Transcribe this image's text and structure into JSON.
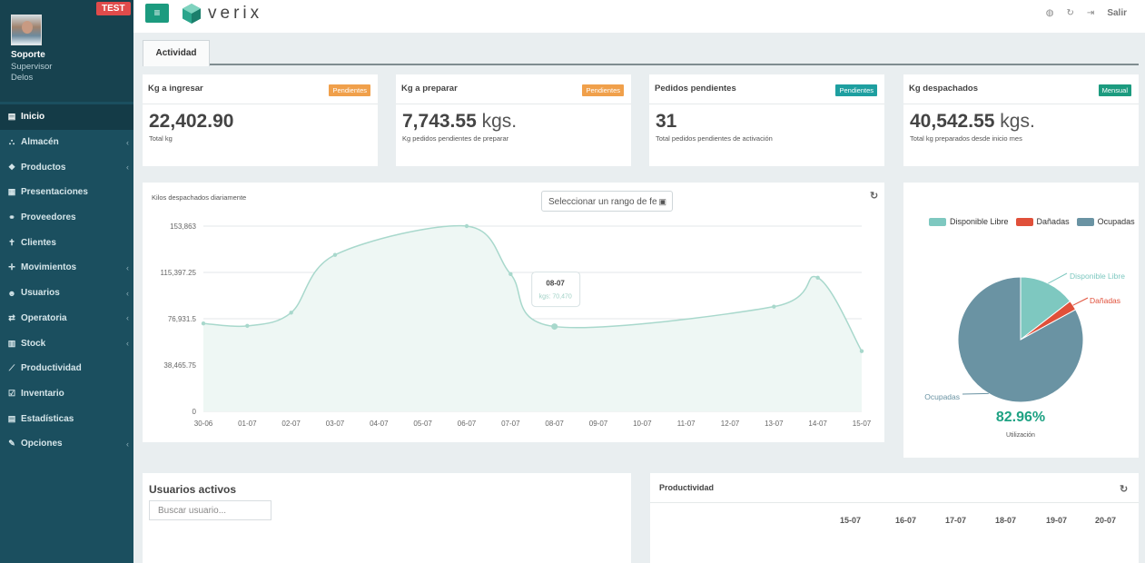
{
  "app": {
    "logo_text": "verix",
    "menu_glyph": "≡"
  },
  "badge": {
    "test": "TEST"
  },
  "user": {
    "name": "Soporte",
    "role": "Supervisor",
    "company": "Delos"
  },
  "sidebar": {
    "items": [
      {
        "label": "Inicio",
        "icon": "bar-chart-icon",
        "glyph": "▤",
        "chevron": false,
        "active": true
      },
      {
        "label": "Almacén",
        "icon": "sitemap-icon",
        "glyph": "⛬",
        "chevron": true
      },
      {
        "label": "Productos",
        "icon": "cubes-icon",
        "glyph": "❖",
        "chevron": true
      },
      {
        "label": "Presentaciones",
        "icon": "box-icon",
        "glyph": "▦",
        "chevron": false
      },
      {
        "label": "Proveedores",
        "icon": "handshake-icon",
        "glyph": "⚭",
        "chevron": false
      },
      {
        "label": "Clientes",
        "icon": "user-icon",
        "glyph": "✝",
        "chevron": false
      },
      {
        "label": "Movimientos",
        "icon": "arrows-icon",
        "glyph": "✛",
        "chevron": true
      },
      {
        "label": "Usuarios",
        "icon": "users-icon",
        "glyph": "☻",
        "chevron": true
      },
      {
        "label": "Operatoria",
        "icon": "exchange-icon",
        "glyph": "⇄",
        "chevron": true
      },
      {
        "label": "Stock",
        "icon": "database-icon",
        "glyph": "▥",
        "chevron": true
      },
      {
        "label": "Productividad",
        "icon": "line-chart-icon",
        "glyph": "⟋",
        "chevron": false
      },
      {
        "label": "Inventario",
        "icon": "check-square-icon",
        "glyph": "☑",
        "chevron": false
      },
      {
        "label": "Estadísticas",
        "icon": "bar-chart-icon",
        "glyph": "▤",
        "chevron": false
      },
      {
        "label": "Opciones",
        "icon": "wrench-icon",
        "glyph": "✎",
        "chevron": true
      }
    ]
  },
  "topbar": {
    "salir_label": "Salir"
  },
  "tabs": [
    {
      "label": "Actividad",
      "active": true
    }
  ],
  "stats": [
    {
      "title": "Kg a ingresar",
      "badge": "Pendientes",
      "badge_color": "#f0a04b",
      "value": "22,402.90",
      "unit": "",
      "sub": "Total kg"
    },
    {
      "title": "Kg a preparar",
      "badge": "Pendientes",
      "badge_color": "#f0a04b",
      "value": "7,743.55",
      "unit": "kgs.",
      "sub": "Kg pedidos pendientes de preparar"
    },
    {
      "title": "Pedidos pendientes",
      "badge": "Pendientes",
      "badge_color": "#1e9fa0",
      "value": "31",
      "unit": "",
      "sub": "Total pedidos pendientes de activación"
    },
    {
      "title": "Kg despachados",
      "badge": "Mensual",
      "badge_color": "#1c9b7f",
      "value": "40,542.55",
      "unit": "kgs.",
      "sub": "Total kg preparados desde inicio mes"
    }
  ],
  "line_chart": {
    "title": "Kilos despachados diariamente",
    "date_placeholder": "Seleccionar un rango de fe",
    "tooltip": {
      "label": "08-07",
      "value_text": "kgs: 70,470"
    }
  },
  "pie_panel": {
    "value_text": "82.96%",
    "caption": "Utilización"
  },
  "users_panel": {
    "title": "Usuarios activos",
    "search_placeholder": "Buscar usuario..."
  },
  "productivity_panel": {
    "title": "Productividad",
    "dates": [
      "15-07",
      "16-07",
      "17-07",
      "18-07",
      "19-07",
      "20-07"
    ]
  },
  "colors": {
    "sidebar": "#1b4f5f",
    "accent": "#1c9b7f",
    "line": "#a8d8cc",
    "pie_free": "#7ec8c0",
    "pie_damaged": "#e0503a",
    "pie_occupied": "#6a93a3"
  },
  "chart_data": [
    {
      "type": "area",
      "title": "Kilos despachados diariamente",
      "categories": [
        "30-06",
        "01-07",
        "02-07",
        "03-07",
        "04-07",
        "05-07",
        "06-07",
        "07-07",
        "08-07",
        "09-07",
        "10-07",
        "11-07",
        "12-07",
        "13-07",
        "14-07",
        "15-07"
      ],
      "y_ticks": [
        "0",
        "38,465.75",
        "76,931.5",
        "115,397.25",
        "153,863"
      ],
      "ylim": [
        0,
        153863
      ],
      "points": [
        {
          "x": 0,
          "y": 73000
        },
        {
          "x": 1,
          "y": 71000
        },
        {
          "x": 2,
          "y": 82000
        },
        {
          "x": 3,
          "y": 130000
        },
        {
          "x": 6,
          "y": 153863
        },
        {
          "x": 7,
          "y": 114000
        },
        {
          "x": 8,
          "y": 70470
        },
        {
          "x": 13,
          "y": 87000
        },
        {
          "x": 14,
          "y": 111000
        },
        {
          "x": 15,
          "y": 50000
        }
      ],
      "grid": true
    },
    {
      "type": "pie",
      "series": [
        {
          "name": "Disponible Libre",
          "value": 14.5,
          "color": "#7ec8c0"
        },
        {
          "name": "Dañadas",
          "value": 2.54,
          "color": "#e0503a"
        },
        {
          "name": "Ocupadas",
          "value": 82.96,
          "color": "#6a93a3"
        }
      ],
      "legend": "top"
    }
  ]
}
